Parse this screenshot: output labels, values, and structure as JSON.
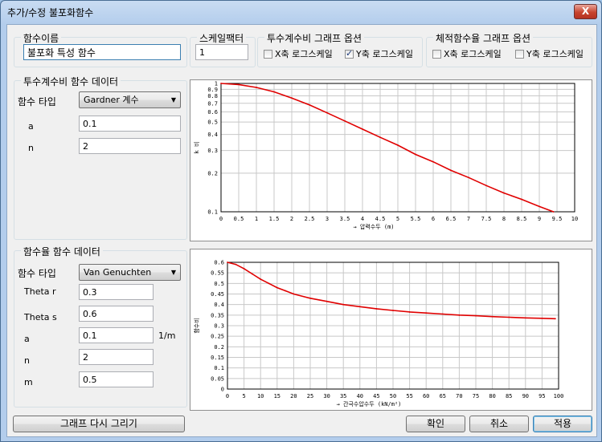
{
  "window": {
    "title": "추가/수정 불포화함수",
    "close_glyph": "X"
  },
  "func_name": {
    "label": "함수이름",
    "value": "불포화 특성 함수"
  },
  "scale": {
    "label": "스케일팩터",
    "value": "1"
  },
  "perm_graph_opts": {
    "label": "투수계수비 그래프 옵션",
    "x_log": {
      "label": "X축 로그스케일",
      "checked": false
    },
    "y_log": {
      "label": "Y축 로그스케일",
      "checked": true
    }
  },
  "vol_graph_opts": {
    "label": "체적함수율 그래프 옵션",
    "x_log": {
      "label": "X축 로그스케일",
      "checked": false
    },
    "y_log": {
      "label": "Y축 로그스케일",
      "checked": false
    }
  },
  "perm_data": {
    "label": "투수계수비 함수 데이터",
    "type_label": "함수 타입",
    "type_value": "Gardner 계수",
    "params": [
      {
        "name": "a",
        "value": "0.1"
      },
      {
        "name": "n",
        "value": "2"
      }
    ]
  },
  "vol_data": {
    "label": "함수율 함수 데이터",
    "type_label": "함수 타입",
    "type_value": "Van Genuchten",
    "params": [
      {
        "name": "Theta r",
        "value": "0.3",
        "unit": ""
      },
      {
        "name": "Theta s",
        "value": "0.6",
        "unit": ""
      },
      {
        "name": "a",
        "value": "0.1",
        "unit": "1/m"
      },
      {
        "name": "n",
        "value": "2",
        "unit": ""
      },
      {
        "name": "m",
        "value": "0.5",
        "unit": ""
      }
    ]
  },
  "buttons": {
    "redraw": "그래프 다시 그리기",
    "ok": "확인",
    "cancel": "취소",
    "apply": "적용"
  },
  "colors": {
    "curve": "#e00000",
    "grid": "#c8c8c8"
  },
  "chart_data": [
    {
      "type": "line",
      "xlabel": "→ 압력수두 (m)",
      "ylabel": "k 비",
      "xlim": [
        0,
        10
      ],
      "ylim": [
        0.1,
        1
      ],
      "ylog": true,
      "xticks": [
        "0",
        "0.5",
        "1",
        "1.5",
        "2",
        "2.5",
        "3",
        "3.5",
        "4",
        "4.5",
        "5",
        "5.5",
        "6",
        "6.5",
        "7",
        "7.5",
        "8",
        "8.5",
        "9",
        "9.5",
        "10"
      ],
      "yticks": [
        "1",
        "0.9",
        "0.8",
        "0.7",
        "0.6",
        "0.5",
        "0.4",
        "0.3",
        "0.2",
        "0.1"
      ],
      "series": [
        {
          "x": [
            0,
            0.5,
            1,
            1.5,
            2,
            2.5,
            3,
            3.5,
            4,
            4.5,
            5,
            5.5,
            6,
            6.5,
            7,
            7.5,
            8,
            8.5,
            9,
            9.4
          ],
          "y": [
            1.0,
            0.98,
            0.93,
            0.86,
            0.77,
            0.68,
            0.59,
            0.51,
            0.44,
            0.38,
            0.33,
            0.28,
            0.245,
            0.21,
            0.185,
            0.16,
            0.14,
            0.125,
            0.11,
            0.1
          ]
        }
      ]
    },
    {
      "type": "line",
      "xlabel": "→ 간극수압수두 (kN/m²)",
      "ylabel": "함수비",
      "xlim": [
        0,
        100
      ],
      "ylim": [
        0,
        0.6
      ],
      "xticks": [
        "0",
        "5",
        "10",
        "15",
        "20",
        "25",
        "30",
        "35",
        "40",
        "45",
        "50",
        "55",
        "60",
        "65",
        "70",
        "75",
        "80",
        "85",
        "90",
        "95",
        "100"
      ],
      "yticks": [
        "0.6",
        "0.55",
        "0.5",
        "0.45",
        "0.4",
        "0.35",
        "0.3",
        "0.25",
        "0.2",
        "0.15",
        "0.1",
        "0.05",
        "0"
      ],
      "series": [
        {
          "x": [
            0,
            2.5,
            5,
            7.5,
            10,
            12.5,
            15,
            17.5,
            20,
            25,
            30,
            35,
            40,
            45,
            50,
            55,
            60,
            65,
            70,
            75,
            80,
            85,
            90,
            95,
            99
          ],
          "y": [
            0.6,
            0.59,
            0.57,
            0.545,
            0.52,
            0.5,
            0.48,
            0.465,
            0.45,
            0.43,
            0.415,
            0.4,
            0.39,
            0.38,
            0.372,
            0.365,
            0.36,
            0.355,
            0.35,
            0.347,
            0.343,
            0.34,
            0.337,
            0.335,
            0.333
          ]
        }
      ]
    }
  ]
}
